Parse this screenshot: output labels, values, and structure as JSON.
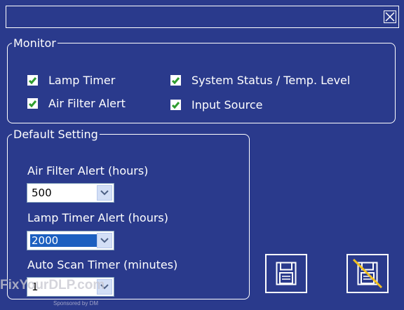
{
  "title_bar": {
    "close_icon": "close-icon"
  },
  "monitor": {
    "legend": "Monitor",
    "options": [
      {
        "label": "Lamp Timer",
        "checked": true
      },
      {
        "label": "Air Filter Alert",
        "checked": true
      },
      {
        "label": "System Status / Temp. Level",
        "checked": true
      },
      {
        "label": "Input Source",
        "checked": true
      }
    ]
  },
  "default_setting": {
    "legend": "Default Setting",
    "air_filter_alert": {
      "label": "Air Filter Alert (hours)",
      "value": "500"
    },
    "lamp_timer_alert": {
      "label": "Lamp Timer Alert (hours)",
      "value": "2000"
    },
    "auto_scan_timer": {
      "label": "Auto Scan Timer (minutes)",
      "value": "1"
    }
  },
  "buttons": {
    "save_icon": "floppy-disk-icon",
    "discard_icon": "floppy-disk-crossed-icon"
  },
  "watermark": {
    "text": "FixYourDLP.com",
    "sponsor": "Sponsored by DM"
  },
  "colors": {
    "background": "#2a3a8c",
    "check": "#2e9c2e",
    "selection": "#1c5fc0",
    "strike": "#f0c020"
  }
}
